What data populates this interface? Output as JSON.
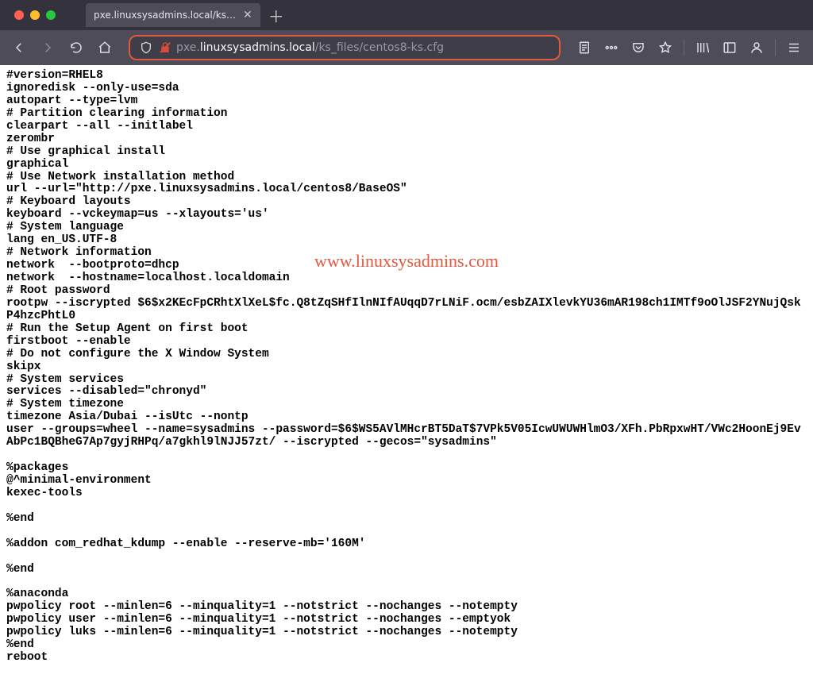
{
  "tab": {
    "title": "pxe.linuxsysadmins.local/ks_files/ce"
  },
  "address": {
    "scheme_dim": "pxe.",
    "host_bright": "linuxsysadmins.local",
    "path_dim": "/ks_files/centos8-ks.cfg"
  },
  "icons": {
    "close": "close-icon",
    "plus": "plus-icon",
    "back": "arrow-left-icon",
    "forward": "arrow-right-icon",
    "reload": "reload-icon",
    "home": "home-icon",
    "shield": "shield-icon",
    "insecure": "lock-slash-icon",
    "reader": "reader-icon",
    "dots": "dots-icon",
    "pocket": "pocket-icon",
    "star": "star-icon",
    "library": "library-icon",
    "sidebar": "sidebar-icon",
    "account": "account-icon",
    "menu": "hamburger-icon"
  },
  "watermark": "www.linuxsysadmins.com",
  "file_content": "#version=RHEL8\nignoredisk --only-use=sda\nautopart --type=lvm\n# Partition clearing information\nclearpart --all --initlabel\nzerombr\n# Use graphical install\ngraphical\n# Use Network installation method\nurl --url=\"http://pxe.linuxsysadmins.local/centos8/BaseOS\"\n# Keyboard layouts\nkeyboard --vckeymap=us --xlayouts='us'\n# System language\nlang en_US.UTF-8\n# Network information\nnetwork  --bootproto=dhcp\nnetwork  --hostname=localhost.localdomain\n# Root password\nrootpw --iscrypted $6$x2KEcFpCRhtXlXeL$fc.Q8tZqSHfIlnNIfAUqqD7rLNiF.ocm/esbZAIXlevkYU36mAR198ch1IMTf9oOlJSF2YNujQskP4hzcPhtL0\n# Run the Setup Agent on first boot\nfirstboot --enable\n# Do not configure the X Window System\nskipx\n# System services\nservices --disabled=\"chronyd\"\n# System timezone\ntimezone Asia/Dubai --isUtc --nontp\nuser --groups=wheel --name=sysadmins --password=$6$WS5AVlMHcrBT5DaT$7VPk5V05IcwUWUWHlmO3/XFh.PbRpxwHT/VWc2HoonEj9EvAbPc1BQBheG7Ap7gyjRHPq/a7gkhl9lNJJ57zt/ --iscrypted --gecos=\"sysadmins\"\n\n%packages\n@^minimal-environment\nkexec-tools\n\n%end\n\n%addon com_redhat_kdump --enable --reserve-mb='160M'\n\n%end\n\n%anaconda\npwpolicy root --minlen=6 --minquality=1 --notstrict --nochanges --notempty\npwpolicy user --minlen=6 --minquality=1 --notstrict --nochanges --emptyok\npwpolicy luks --minlen=6 --minquality=1 --notstrict --nochanges --notempty\n%end\nreboot"
}
